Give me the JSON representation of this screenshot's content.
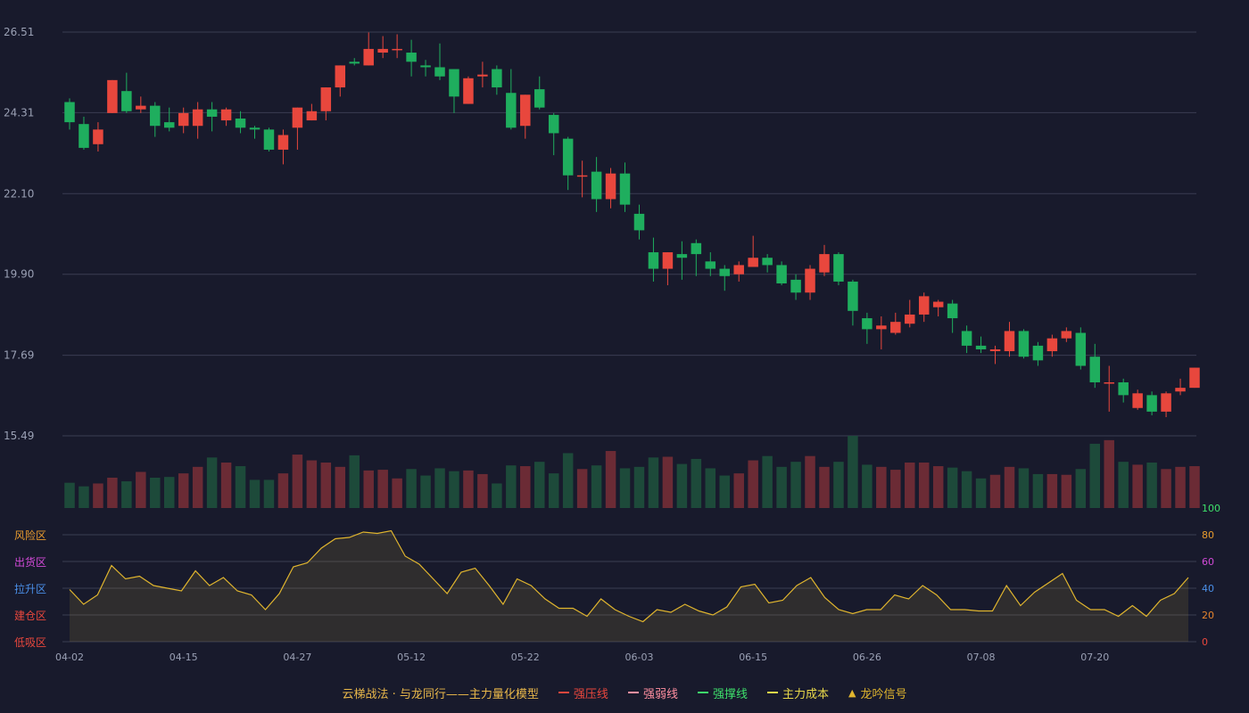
{
  "colors": {
    "background": "#181a2c",
    "up": "#e8473d",
    "down": "#1fae5e",
    "vol_up": "#6b2b35",
    "vol_down": "#1d4a3a",
    "grid": "#3a3d52",
    "tick": "#9aa0b4",
    "gold": "#e0b52e",
    "strong_resist": "#e8473d",
    "strong_weak": "#ff8fa0",
    "strong_support": "#3ee06b",
    "main_cost": "#e8d84a"
  },
  "chart_data": [
    {
      "type": "candlestick",
      "price_axis": {
        "ticks": [
          "26.51",
          "24.31",
          "22.10",
          "19.90",
          "17.69",
          "15.49"
        ],
        "ylim": [
          15.49,
          26.51
        ]
      },
      "x_ticks": [
        {
          "index": 0,
          "label": "04-02"
        },
        {
          "index": 8,
          "label": "04-15"
        },
        {
          "index": 16,
          "label": "04-27"
        },
        {
          "index": 24,
          "label": "05-12"
        },
        {
          "index": 32,
          "label": "05-22"
        },
        {
          "index": 40,
          "label": "06-03"
        },
        {
          "index": 48,
          "label": "06-15"
        },
        {
          "index": 56,
          "label": "06-26"
        },
        {
          "index": 64,
          "label": "07-08"
        },
        {
          "index": 72,
          "label": "07-20"
        }
      ],
      "ohlc": [
        [
          24.6,
          24.05,
          24.7,
          23.85
        ],
        [
          24.0,
          23.35,
          24.2,
          23.3
        ],
        [
          23.45,
          23.85,
          24.05,
          23.25
        ],
        [
          24.3,
          25.2,
          25.2,
          24.3
        ],
        [
          24.9,
          24.35,
          25.4,
          24.3
        ],
        [
          24.4,
          24.5,
          24.75,
          24.3
        ],
        [
          24.5,
          23.95,
          24.6,
          23.65
        ],
        [
          24.05,
          23.9,
          24.45,
          23.8
        ],
        [
          23.95,
          24.3,
          24.45,
          23.75
        ],
        [
          23.95,
          24.4,
          24.6,
          23.6
        ],
        [
          24.4,
          24.2,
          24.6,
          23.8
        ],
        [
          24.1,
          24.4,
          24.45,
          23.95
        ],
        [
          24.15,
          23.9,
          24.35,
          23.75
        ],
        [
          23.9,
          23.85,
          23.95,
          23.6
        ],
        [
          23.85,
          23.3,
          23.9,
          23.25
        ],
        [
          23.3,
          23.7,
          23.85,
          22.9
        ],
        [
          23.9,
          24.45,
          24.45,
          23.3
        ],
        [
          24.1,
          24.35,
          24.55,
          24.1
        ],
        [
          24.35,
          25.0,
          25.0,
          24.1
        ],
        [
          25.0,
          25.6,
          25.6,
          24.75
        ],
        [
          25.7,
          25.65,
          25.8,
          25.6
        ],
        [
          25.6,
          26.05,
          26.5,
          25.6
        ],
        [
          25.95,
          26.05,
          26.4,
          25.8
        ],
        [
          26.05,
          26.05,
          26.45,
          25.8
        ],
        [
          25.95,
          25.7,
          26.3,
          25.3
        ],
        [
          25.6,
          25.55,
          25.75,
          25.3
        ],
        [
          25.55,
          25.3,
          26.2,
          25.2
        ],
        [
          25.5,
          24.75,
          25.5,
          24.3
        ],
        [
          24.55,
          25.25,
          25.3,
          24.55
        ],
        [
          25.3,
          25.35,
          25.7,
          25.0
        ],
        [
          25.5,
          25.0,
          25.6,
          24.8
        ],
        [
          24.85,
          23.9,
          25.5,
          23.85
        ],
        [
          23.95,
          24.8,
          24.8,
          23.6
        ],
        [
          24.95,
          24.45,
          25.3,
          24.4
        ],
        [
          24.25,
          23.75,
          24.3,
          23.15
        ],
        [
          23.6,
          22.6,
          23.65,
          22.2
        ],
        [
          22.6,
          22.6,
          23.0,
          22.0
        ],
        [
          22.7,
          21.95,
          23.1,
          21.6
        ],
        [
          21.95,
          22.65,
          22.8,
          21.7
        ],
        [
          22.65,
          21.8,
          22.95,
          21.6
        ],
        [
          21.55,
          21.1,
          21.8,
          20.85
        ],
        [
          20.5,
          20.05,
          20.9,
          19.7
        ],
        [
          20.05,
          20.5,
          20.5,
          19.6
        ],
        [
          20.45,
          20.35,
          20.8,
          19.75
        ],
        [
          20.75,
          20.45,
          20.85,
          19.85
        ],
        [
          20.25,
          20.05,
          20.5,
          19.85
        ],
        [
          20.05,
          19.85,
          20.15,
          19.45
        ],
        [
          19.9,
          20.15,
          20.25,
          19.7
        ],
        [
          20.1,
          20.35,
          20.95,
          20.1
        ],
        [
          20.35,
          20.15,
          20.45,
          19.95
        ],
        [
          20.15,
          19.65,
          20.25,
          19.6
        ],
        [
          19.75,
          19.4,
          19.9,
          19.2
        ],
        [
          19.4,
          20.05,
          20.15,
          19.2
        ],
        [
          19.95,
          20.45,
          20.7,
          19.85
        ],
        [
          20.45,
          19.7,
          20.5,
          19.6
        ],
        [
          19.7,
          18.9,
          19.75,
          18.5
        ],
        [
          18.7,
          18.4,
          18.85,
          18.0
        ],
        [
          18.4,
          18.5,
          18.75,
          17.85
        ],
        [
          18.3,
          18.6,
          18.85,
          18.25
        ],
        [
          18.55,
          18.8,
          19.2,
          18.45
        ],
        [
          18.8,
          19.3,
          19.4,
          18.6
        ],
        [
          19.0,
          19.15,
          19.2,
          18.75
        ],
        [
          19.1,
          18.7,
          19.2,
          18.3
        ],
        [
          18.35,
          17.95,
          18.5,
          17.75
        ],
        [
          17.95,
          17.85,
          18.2,
          17.75
        ],
        [
          17.8,
          17.85,
          17.95,
          17.45
        ],
        [
          17.8,
          18.35,
          18.6,
          17.65
        ],
        [
          18.35,
          17.65,
          18.4,
          17.6
        ],
        [
          17.95,
          17.55,
          18.05,
          17.4
        ],
        [
          17.8,
          18.15,
          18.25,
          17.65
        ],
        [
          18.15,
          18.35,
          18.45,
          18.05
        ],
        [
          18.3,
          17.4,
          18.45,
          17.3
        ],
        [
          17.65,
          16.95,
          18.0,
          16.8
        ],
        [
          16.95,
          16.95,
          17.4,
          16.15
        ],
        [
          16.95,
          16.6,
          17.05,
          16.4
        ],
        [
          16.25,
          16.65,
          16.75,
          16.2
        ],
        [
          16.6,
          16.15,
          16.7,
          16.05
        ],
        [
          16.15,
          16.65,
          16.7,
          16.0
        ],
        [
          16.7,
          16.8,
          17.05,
          16.6
        ],
        [
          16.8,
          17.35,
          17.35,
          16.8
        ]
      ],
      "volume_heights": [
        0.35,
        0.3,
        0.34,
        0.42,
        0.37,
        0.5,
        0.42,
        0.43,
        0.48,
        0.57,
        0.7,
        0.63,
        0.58,
        0.39,
        0.39,
        0.48,
        0.74,
        0.66,
        0.63,
        0.57,
        0.73,
        0.52,
        0.53,
        0.41,
        0.54,
        0.45,
        0.55,
        0.51,
        0.52,
        0.47,
        0.34,
        0.59,
        0.58,
        0.64,
        0.48,
        0.76,
        0.54,
        0.59,
        0.79,
        0.55,
        0.57,
        0.7,
        0.71,
        0.61,
        0.68,
        0.55,
        0.45,
        0.48,
        0.66,
        0.72,
        0.57,
        0.64,
        0.72,
        0.57,
        0.64,
        1.0,
        0.6,
        0.57,
        0.53,
        0.63,
        0.63,
        0.58,
        0.56,
        0.51,
        0.41,
        0.46,
        0.57,
        0.55,
        0.47,
        0.47,
        0.46,
        0.54,
        0.89,
        0.94,
        0.64,
        0.6,
        0.63,
        0.54,
        0.57,
        0.58
      ]
    },
    {
      "type": "line",
      "y_ticks_right": [
        "100",
        "80",
        "60",
        "40",
        "20",
        "0"
      ],
      "ylim": [
        0,
        100
      ],
      "zones": [
        "风险区",
        "出货区",
        "拉升区",
        "建仓区",
        "低吸区"
      ],
      "values": [
        39,
        28,
        35,
        57,
        47,
        49,
        42,
        40,
        38,
        53,
        42,
        48,
        38,
        35,
        24,
        36,
        56,
        59,
        70,
        77,
        78,
        82,
        81,
        83,
        64,
        58,
        47,
        36,
        52,
        55,
        42,
        28,
        47,
        42,
        32,
        25,
        25,
        19,
        32,
        24,
        19,
        15,
        24,
        22,
        28,
        23,
        20,
        26,
        41,
        43,
        29,
        31,
        42,
        48,
        33,
        24,
        21,
        24,
        24,
        35,
        32,
        42,
        35,
        24,
        24,
        23,
        23,
        42,
        27,
        37,
        44,
        51,
        31,
        24,
        24,
        19,
        27,
        19,
        31,
        36,
        48
      ]
    }
  ],
  "legend": {
    "title": "云梯战法 · 与龙同行——主力量化模型",
    "items": [
      {
        "label": "强压线",
        "color": "#e8473d",
        "style": "solid"
      },
      {
        "label": "强弱线",
        "color": "#ff8fa0",
        "style": "dashed"
      },
      {
        "label": "强撑线",
        "color": "#3ee06b",
        "style": "solid"
      },
      {
        "label": "主力成本",
        "color": "#e8d84a",
        "style": "dashed"
      },
      {
        "label": "龙吟信号",
        "icon": "triangle-up-icon",
        "color": "#e0b52e"
      }
    ]
  }
}
